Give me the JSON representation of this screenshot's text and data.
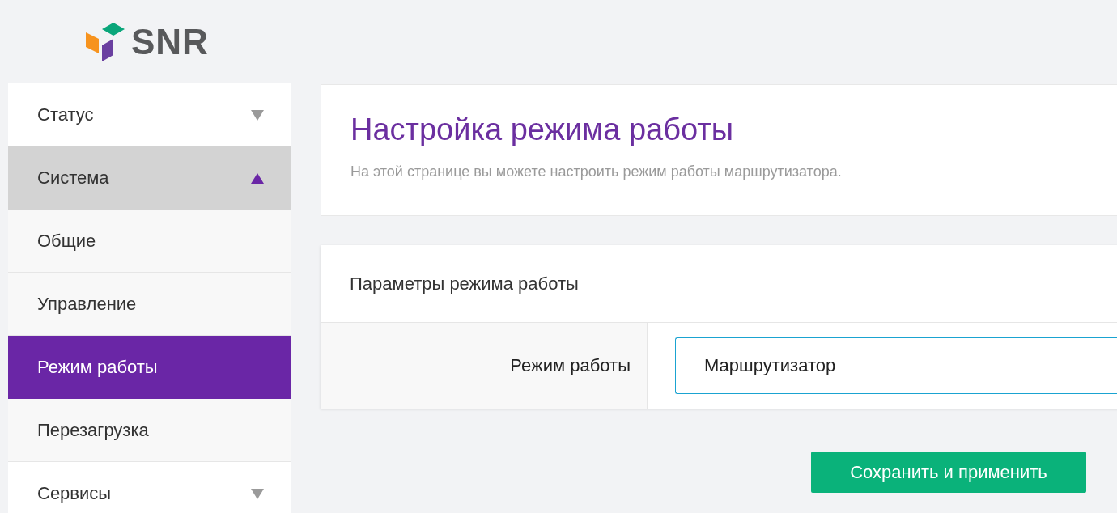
{
  "logo": {
    "text": "SNR"
  },
  "sidebar": {
    "items": [
      {
        "label": "Статус",
        "expanded": false
      },
      {
        "label": "Система",
        "expanded": true,
        "children": [
          {
            "label": "Общие",
            "selected": false
          },
          {
            "label": "Управление",
            "selected": false
          },
          {
            "label": "Режим работы",
            "selected": true
          },
          {
            "label": "Перезагрузка",
            "selected": false
          }
        ]
      },
      {
        "label": "Сервисы",
        "expanded": false
      }
    ]
  },
  "header": {
    "title": "Настройка режима работы",
    "description": "На этой странице вы можете настроить режим работы маршрутизатора."
  },
  "settings": {
    "title": "Параметры режима работы",
    "fields": [
      {
        "label": "Режим работы",
        "value": "Маршрутизатор"
      }
    ]
  },
  "save_button": "Сохранить и применить"
}
